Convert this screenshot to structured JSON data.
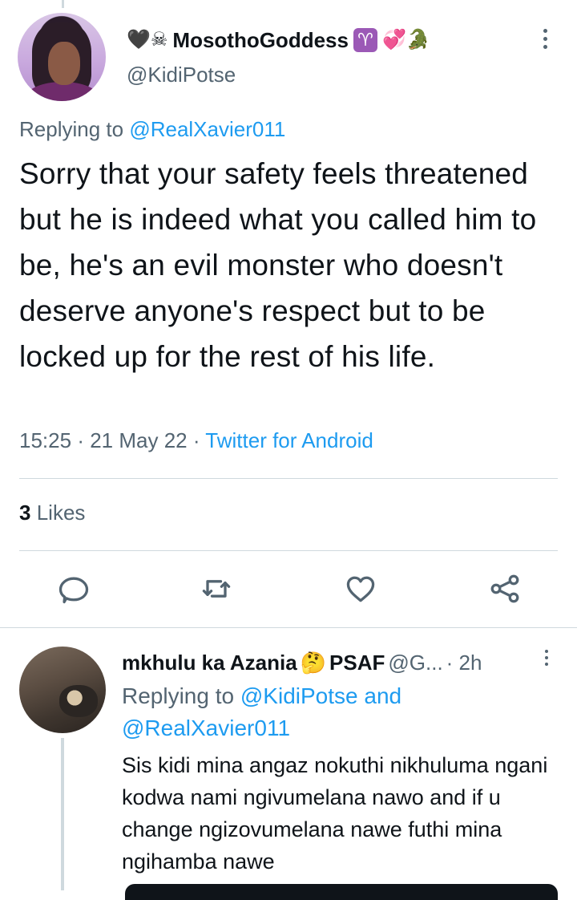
{
  "tweet": {
    "author": {
      "emoji_prefix": "🖤☠",
      "name": "MosothoGoddess",
      "aries_symbol": "♈",
      "emoji_suffix": "💞🐊",
      "handle": "@KidiPotse"
    },
    "replying_label": "Replying to",
    "replying_to": "@RealXavier011",
    "text": "Sorry that your safety feels threatened but he is indeed what you called him to be, he's an evil monster who doesn't deserve anyone's respect but to be locked up for the rest of his life.",
    "time": "15:25",
    "date": "21 May 22",
    "source": "Twitter for Android",
    "likes_count": "3",
    "likes_label": "Likes"
  },
  "reply": {
    "name": "mkhulu ka Azania",
    "name_emoji": "🤔",
    "name_suffix": "PSAF",
    "handle": "@G...",
    "time": "· 2h",
    "replying_label": "Replying to",
    "replying_to_1": "@KidiPotse",
    "replying_and": "and",
    "replying_to_2": "@RealXavier011",
    "text": "Sis kidi mina angaz nokuthi nikhuluma ngani kodwa nami ngivumelana nawo and if u change ngizovumelana nawe futhi mina ngihamba nawe"
  },
  "colors": {
    "link": "#1d9bf0",
    "secondary_text": "#536471",
    "primary_text": "#0f1419",
    "divider": "#cfd9de"
  },
  "icons": [
    "more-icon",
    "reply-icon",
    "retweet-icon",
    "like-icon",
    "share-icon"
  ]
}
